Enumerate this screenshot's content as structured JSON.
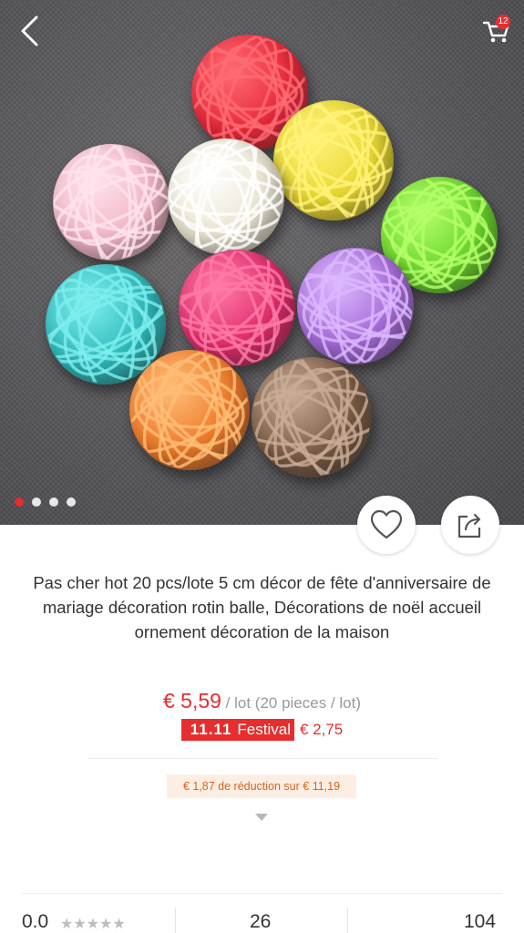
{
  "header": {
    "back_icon": "chevron-left-icon",
    "cart_icon": "cart-icon",
    "cart_count": "12"
  },
  "gallery": {
    "image_count": 4,
    "active_index": 0
  },
  "actions": {
    "wishlist_icon": "heart-icon",
    "share_icon": "share-icon"
  },
  "product": {
    "title": "Pas cher hot 20 pcs/lote 5 cm décor de fête d'anniversaire de mariage décoration rotin balle, Décorations de noël accueil ornement décoration de la maison",
    "price": "€ 5,59",
    "unit": " / lot (20 pieces / lot)",
    "festival_number": "11.11",
    "festival_label": "Festival",
    "festival_price": "€ 2,75",
    "discount_text": "€ 1,87 de réduction sur € 11,19"
  },
  "stats": {
    "rating": "0.0",
    "stars": "★★★★★",
    "reviews": "26",
    "orders": "104"
  },
  "colors": {
    "accent": "#e62e2e",
    "discount_bg": "#fdeee4",
    "discount_text": "#d4651c"
  }
}
